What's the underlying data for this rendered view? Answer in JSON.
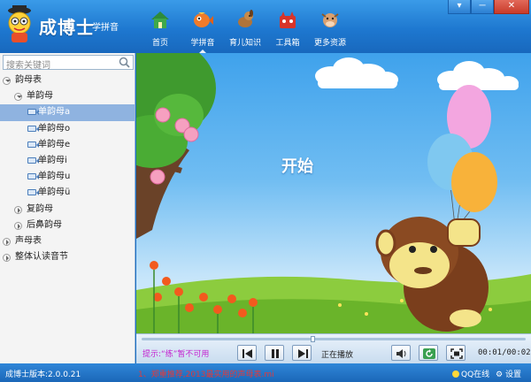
{
  "app": {
    "title": "成博士",
    "subtitle": "学拼音"
  },
  "window_buttons": [
    "▾",
    "─",
    "✕"
  ],
  "nav": [
    {
      "label": "首页",
      "icon": "house-icon"
    },
    {
      "label": "学拼音",
      "icon": "fish-icon",
      "active": true
    },
    {
      "label": "育儿知识",
      "icon": "dog-icon"
    },
    {
      "label": "工具箱",
      "icon": "toolbox-icon"
    },
    {
      "label": "更多资源",
      "icon": "cow-icon"
    }
  ],
  "search": {
    "placeholder": "搜索关键词"
  },
  "tree": [
    {
      "label": "韵母表",
      "level": 0,
      "type": "folder",
      "expanded": true
    },
    {
      "label": "单韵母",
      "level": 1,
      "type": "folder",
      "expanded": true
    },
    {
      "label": "单韵母a",
      "level": 2,
      "type": "video",
      "selected": true
    },
    {
      "label": "单韵母o",
      "level": 2,
      "type": "video"
    },
    {
      "label": "单韵母e",
      "level": 2,
      "type": "video"
    },
    {
      "label": "单韵母i",
      "level": 2,
      "type": "video"
    },
    {
      "label": "单韵母u",
      "level": 2,
      "type": "video"
    },
    {
      "label": "单韵母ü",
      "level": 2,
      "type": "video"
    },
    {
      "label": "复韵母",
      "level": 1,
      "type": "folder",
      "expanded": false
    },
    {
      "label": "后鼻韵母",
      "level": 1,
      "type": "folder",
      "expanded": false
    },
    {
      "label": "声母表",
      "level": 0,
      "type": "folder",
      "expanded": false
    },
    {
      "label": "整体认读音节",
      "level": 0,
      "type": "folder",
      "expanded": false
    }
  ],
  "scene": {
    "start_label": "开始"
  },
  "player": {
    "hint": "提示:“练”暂不可用",
    "status": "正在播放",
    "time": "00:01/00:02",
    "progress": 0.44
  },
  "statusbar": {
    "version": "成博士版本:2.0.0.21",
    "marquee": "1、郑重推荐,2013最实用的声母表.mi",
    "qq": "QQ在线",
    "settings": "设置"
  },
  "colors": {
    "titlebar": "#1e78d0",
    "selected": "#8fb3e0",
    "hint": "#c21fcf",
    "marquee": "#e23a3a"
  }
}
